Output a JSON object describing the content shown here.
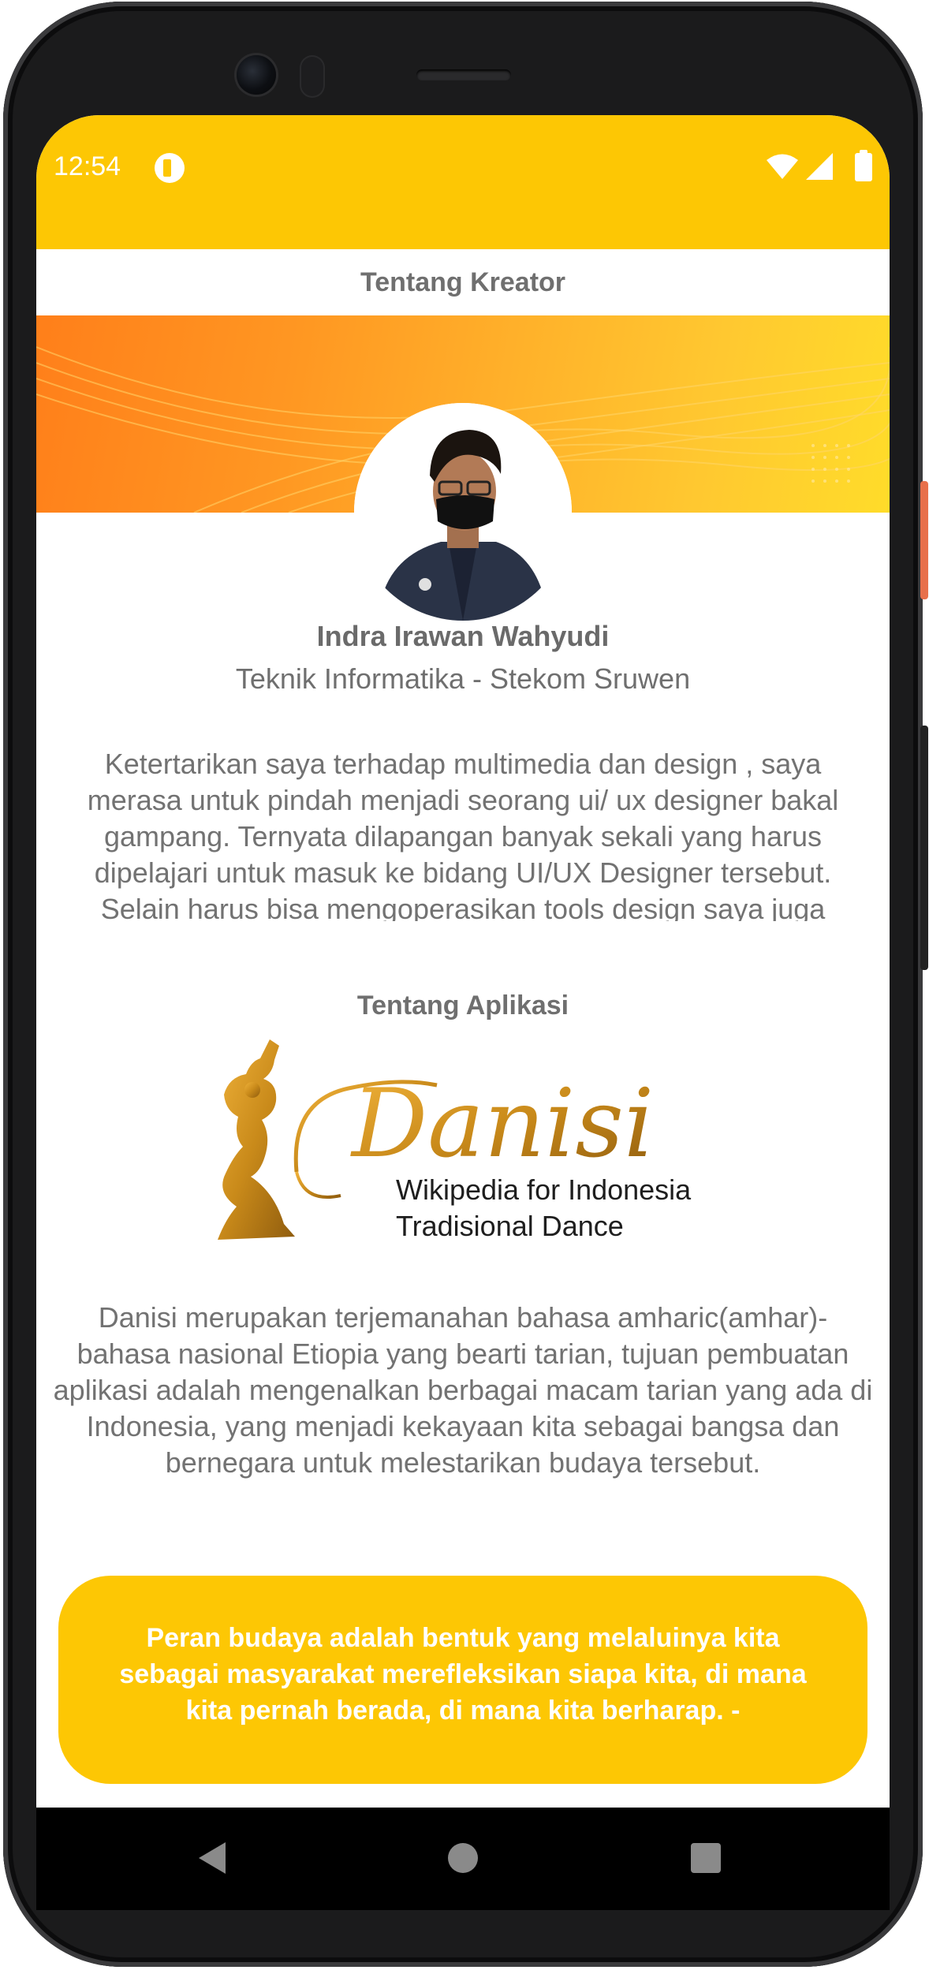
{
  "status_bar": {
    "time": "12:54",
    "icons": [
      "app-notification-icon",
      "wifi-icon",
      "signal-icon",
      "battery-icon"
    ]
  },
  "header": {
    "title": "Tentang Kreator"
  },
  "creator": {
    "name": "Indra Irawan Wahyudi",
    "subtitle": "Teknik Informatika - Stekom Sruwen",
    "bio": "Ketertarikan saya terhadap multimedia dan design , saya merasa untuk pindah menjadi seorang ui/ ux designer bakal gampang. Ternyata dilapangan banyak sekali yang harus dipelajari untuk masuk ke bidang UI/UX Designer tersebut. Selain harus bisa mengoperasikan tools design saya juga harus mengerti"
  },
  "app_section": {
    "title": "Tentang Aplikasi",
    "logo": {
      "wordmark": "Danisi",
      "tagline_line1": "Wikipedia for Indonesia",
      "tagline_line2": "Tradisional Dance"
    },
    "description": "Danisi merupakan terjemanahan bahasa amharic(amhar)- bahasa nasional Etiopia yang bearti tarian, tujuan pembuatan aplikasi adalah mengenalkan berbagai macam tarian yang ada di Indonesia, yang menjadi kekayaan kita sebagai bangsa dan bernegara untuk melestarikan budaya tersebut."
  },
  "quote": {
    "text": "Peran budaya adalah bentuk yang melaluinya kita sebagai masyarakat merefleksikan siapa kita, di mana kita pernah berada, di mana kita berharap. -"
  },
  "colors": {
    "primary_yellow": "#FDC704",
    "banner_orange": "#FF8A1E",
    "text_gray": "#6F6F6F",
    "logo_gold": "#C98A1A"
  },
  "nav": {
    "buttons": [
      "back-icon",
      "home-icon",
      "recents-icon"
    ]
  }
}
